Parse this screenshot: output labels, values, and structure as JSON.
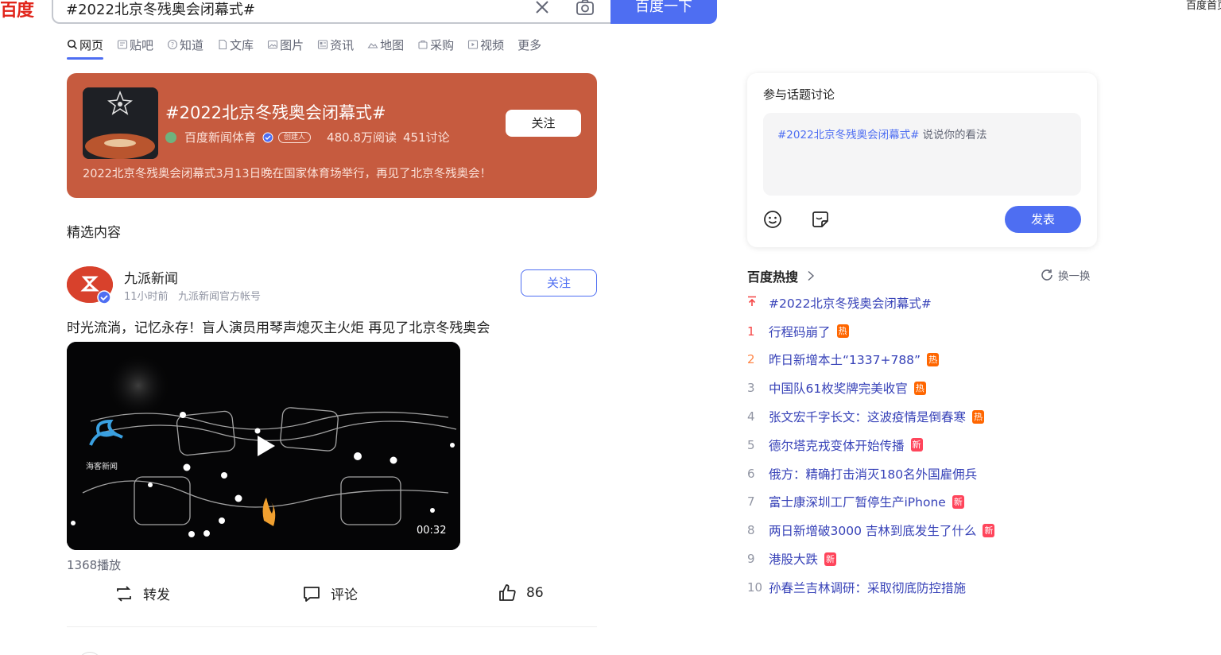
{
  "header": {
    "logo": "百度",
    "search_value": "#2022北京冬残奥会闭幕式#",
    "search_button": "百度一下",
    "top_right_link": "百度首页"
  },
  "tabs": [
    {
      "label": "网页",
      "icon": "search-icon"
    },
    {
      "label": "贴吧",
      "icon": "tieba-icon"
    },
    {
      "label": "知道",
      "icon": "question-icon"
    },
    {
      "label": "文库",
      "icon": "doc-icon"
    },
    {
      "label": "图片",
      "icon": "image-icon"
    },
    {
      "label": "资讯",
      "icon": "news-icon"
    },
    {
      "label": "地图",
      "icon": "map-icon"
    },
    {
      "label": "采购",
      "icon": "cart-icon"
    },
    {
      "label": "视频",
      "icon": "video-icon"
    },
    {
      "label": "更多",
      "icon": ""
    }
  ],
  "topic": {
    "title": "#2022北京冬残奥会闭幕式#",
    "source": "百度新闻体育",
    "creator_tag": "创建人",
    "reads": "480.8万阅读",
    "discussions": "451讨论",
    "follow_label": "关注",
    "description": "2022北京冬残奥会闭幕式3月13日晚在国家体育场举行，再见了北京冬残奥会！",
    "bg_color": "#c65b3f"
  },
  "featured_label": "精选内容",
  "post": {
    "author": "九派新闻",
    "time": "11小时前",
    "account_type": "九派新闻官方帐号",
    "follow_label": "关注",
    "text": "时光流淌，记忆永存！盲人演员用琴声熄灭主火炬 再见了北京冬残奥会",
    "video_duration": "00:32",
    "video_watermark": "海客新闻",
    "plays": "1368播放",
    "actions": {
      "repost": "转发",
      "comment": "评论",
      "like_count": "86"
    }
  },
  "discuss": {
    "title": "参与话题讨论",
    "tag": "#2022北京冬残奥会闭幕式#",
    "placeholder": "说说你的看法",
    "publish_label": "发表"
  },
  "hot": {
    "title": "百度热搜",
    "refresh_label": "换一换",
    "items": [
      {
        "rank": "",
        "title": "#2022北京冬残奥会闭幕式#",
        "badge": "",
        "pinned": true
      },
      {
        "rank": "1",
        "title": "行程码崩了",
        "badge": "热"
      },
      {
        "rank": "2",
        "title": "昨日新增本土“1337+788”",
        "badge": "热"
      },
      {
        "rank": "3",
        "title": "中国队61枚奖牌完美收官",
        "badge": "热"
      },
      {
        "rank": "4",
        "title": "张文宏千字长文：这波疫情是倒春寒",
        "badge": "热"
      },
      {
        "rank": "5",
        "title": "德尔塔克戎变体开始传播",
        "badge": "新"
      },
      {
        "rank": "6",
        "title": "俄方：精确打击消灭180名外国雇佣兵",
        "badge": ""
      },
      {
        "rank": "7",
        "title": "富士康深圳工厂暂停生产iPhone",
        "badge": "新"
      },
      {
        "rank": "8",
        "title": "两日新增破3000 吉林到底发生了什么",
        "badge": "新"
      },
      {
        "rank": "9",
        "title": "港股大跌",
        "badge": "新"
      },
      {
        "rank": "10",
        "title": "孙春兰吉林调研：采取彻底防控措施",
        "badge": ""
      }
    ]
  },
  "colors": {
    "accent": "#4e6ef2",
    "hot_badge": "#ff6600",
    "new_badge": "#ff455b",
    "link": "#3742b8"
  }
}
